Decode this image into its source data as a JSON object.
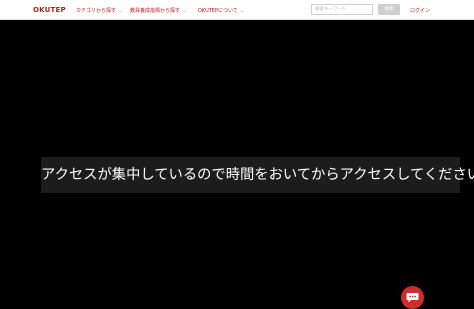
{
  "header": {
    "brand": "OKUTEP",
    "nav": [
      {
        "label": "カテゴリから探す"
      },
      {
        "label": "教員養成指標から探す"
      },
      {
        "label": "OKUTEPについて"
      }
    ],
    "search": {
      "placeholder": "検索キーワード",
      "button_label": "検索"
    },
    "login_label": "ログイン"
  },
  "main": {
    "message": "アクセスが集中しているので時間をおいてからアクセスしてください。"
  },
  "colors": {
    "accent": "#b5201e",
    "background": "#000000",
    "banner": "#1c1c1c",
    "chat": "#c8302c"
  },
  "icons": {
    "nav_chevron": "chevron-down-icon",
    "chat": "chat-bubble-icon"
  }
}
